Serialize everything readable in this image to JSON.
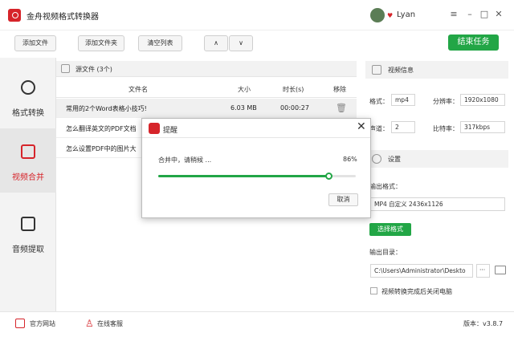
{
  "app": {
    "title": "金舟视频格式转换器",
    "username": "Lyan",
    "version": "版本：v3.8.7"
  },
  "toolbar": {
    "add_file": "添加文件",
    "add_folder": "添加文件夹",
    "clear_list": "清空列表",
    "up": "∧",
    "down": "∨",
    "end_task": "结束任务"
  },
  "sidebar": {
    "items": [
      {
        "label": "格式转换",
        "icon": "play-icon"
      },
      {
        "label": "视频合并",
        "icon": "merge-icon"
      },
      {
        "label": "音频提取",
        "icon": "music-icon"
      }
    ]
  },
  "list": {
    "header": "源文件 (3个)",
    "columns": {
      "name": "文件名",
      "size": "大小",
      "duration": "时长(s)",
      "remove": "移除"
    },
    "rows": [
      {
        "name": "常用的2个Word表格小技巧!",
        "size": "6.03 MB",
        "duration": "00:00:27"
      },
      {
        "name": "怎么翻译英文的PDF文档",
        "size": "",
        "duration": ""
      },
      {
        "name": "怎么设置PDF中的图片大",
        "size": "",
        "duration": ""
      }
    ]
  },
  "video_info": {
    "title": "视频信息",
    "format_label": "格式：",
    "format": "mp4",
    "resolution_label": "分辨率：",
    "resolution": "1920x1080",
    "channel_label": "声道：",
    "channel": "2",
    "bitrate_label": "比特率：",
    "bitrate": "317kbps"
  },
  "settings": {
    "title": "设置",
    "output_format_label": "输出格式：",
    "output_format": "MP4 自定义 2436x1126",
    "choose_format": "选择格式",
    "output_dir_label": "输出目录：",
    "output_dir": "C:\\Users\\Administrator\\Deskto",
    "shutdown_label": "视频转换完成后关闭电脑"
  },
  "footer": {
    "website": "官方网站",
    "support": "在线客服"
  },
  "modal": {
    "title": "提醒",
    "message": "合并中，请稍候 ...",
    "percent_text": "86%",
    "progress": 0.86,
    "cancel": "取消"
  },
  "colors": {
    "brand_red": "#d6242a",
    "accent_green": "#22a646"
  }
}
